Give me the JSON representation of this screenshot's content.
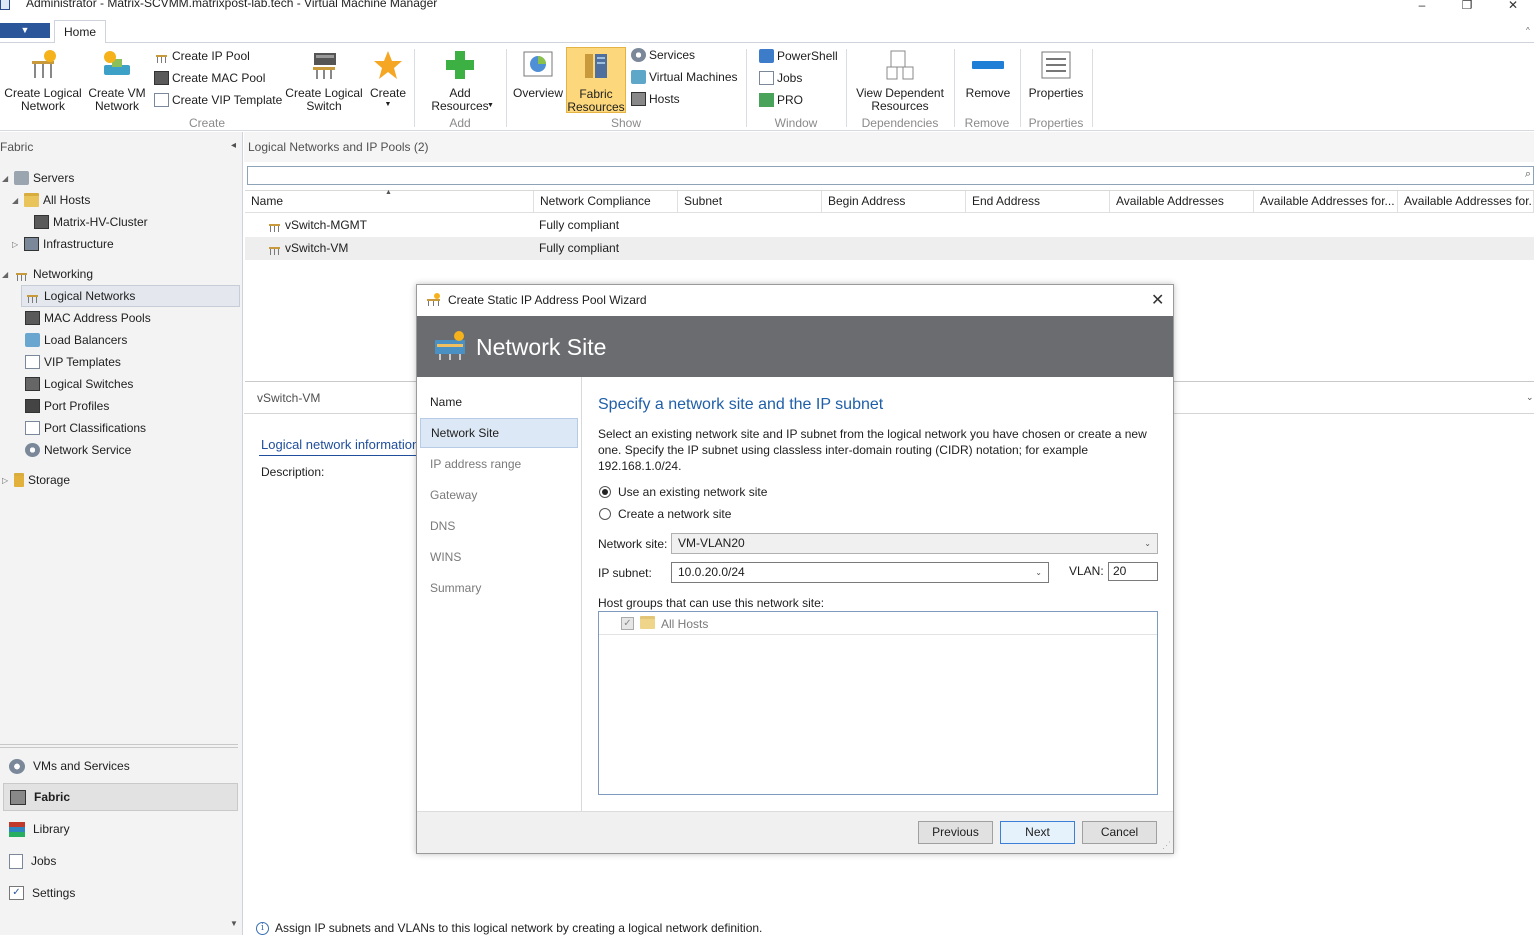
{
  "window": {
    "title": "Administrator - Matrix-SCVMM.matrixpost-lab.tech - Virtual Machine Manager",
    "minimize": "–",
    "restore": "❐",
    "close": "✕"
  },
  "ribbon": {
    "tab_home": "Home",
    "create_group": {
      "label": "Create",
      "create_logical_network": "Create Logical Network",
      "create_vm_network": "Create VM Network",
      "create_ip_pool": "Create IP Pool",
      "create_mac_pool": "Create MAC Pool",
      "create_vip_template": "Create VIP Template",
      "create_logical_switch": "Create Logical Switch",
      "create": "Create"
    },
    "add_group": {
      "label": "Add",
      "add_resources": "Add Resources"
    },
    "show_group": {
      "label": "Show",
      "overview": "Overview",
      "fabric_resources": "Fabric Resources",
      "services": "Services",
      "virtual_machines": "Virtual Machines",
      "hosts": "Hosts"
    },
    "window_group": {
      "label": "Window",
      "powershell": "PowerShell",
      "jobs": "Jobs",
      "pro": "PRO"
    },
    "dependencies_group": {
      "label": "Dependencies",
      "view_dependent": "View Dependent Resources"
    },
    "remove_group": {
      "label": "Remove",
      "remove": "Remove"
    },
    "properties_group": {
      "label": "Properties",
      "properties": "Properties"
    }
  },
  "nav": {
    "header": "Fabric",
    "collapse": "◂",
    "servers": "Servers",
    "all_hosts": "All Hosts",
    "cluster": "Matrix-HV-Cluster",
    "infrastructure": "Infrastructure",
    "networking": "Networking",
    "logical_networks": "Logical Networks",
    "mac_pools": "MAC Address Pools",
    "load_balancers": "Load Balancers",
    "vip_templates": "VIP Templates",
    "logical_switches": "Logical Switches",
    "port_profiles": "Port Profiles",
    "port_classifications": "Port Classifications",
    "network_service": "Network Service",
    "storage": "Storage",
    "workspaces": [
      "VMs and Services",
      "Fabric",
      "Library",
      "Jobs",
      "Settings"
    ]
  },
  "main": {
    "header": "Logical Networks and IP Pools (2)",
    "columns": [
      "Name",
      "Network Compliance",
      "Subnet",
      "Begin Address",
      "End Address",
      "Available Addresses",
      "Available Addresses for...",
      "Available Addresses for..."
    ],
    "rows": [
      {
        "name": "vSwitch-MGMT",
        "compliance": "Fully compliant"
      },
      {
        "name": "vSwitch-VM",
        "compliance": "Fully compliant"
      }
    ]
  },
  "detail": {
    "title": "vSwitch-VM",
    "link": "Logical network information",
    "description_label": "Description:",
    "info": "Assign IP subnets and VLANs to this logical network by creating a logical network definition."
  },
  "wizard": {
    "title": "Create Static IP Address Pool Wizard",
    "close": "✕",
    "banner": "Network Site",
    "steps": [
      "Name",
      "Network Site",
      "IP address range",
      "Gateway",
      "DNS",
      "WINS",
      "Summary"
    ],
    "heading": "Specify a network site and the IP subnet",
    "description": "Select an existing network site and IP subnet from the logical network you have chosen or create a new one. Specify the IP subnet using classless inter-domain routing (CIDR) notation; for example 192.168.1.0/24.",
    "radio_existing": "Use an existing network site",
    "radio_create": "Create a network site",
    "network_site_label": "Network site:",
    "network_site_value": "VM-VLAN20",
    "ip_subnet_label": "IP subnet:",
    "ip_subnet_value": "10.0.20.0/24",
    "vlan_label": "VLAN:",
    "vlan_value": "20",
    "host_groups_label": "Host groups that can use this network site:",
    "host_group": "All Hosts",
    "btn_previous": "Previous",
    "btn_next": "Next",
    "btn_cancel": "Cancel"
  },
  "colors": {
    "accent": "#2b579a",
    "banner": "#6a6c70",
    "heading": "#1f5fa8",
    "selection": "#dde8f6"
  }
}
